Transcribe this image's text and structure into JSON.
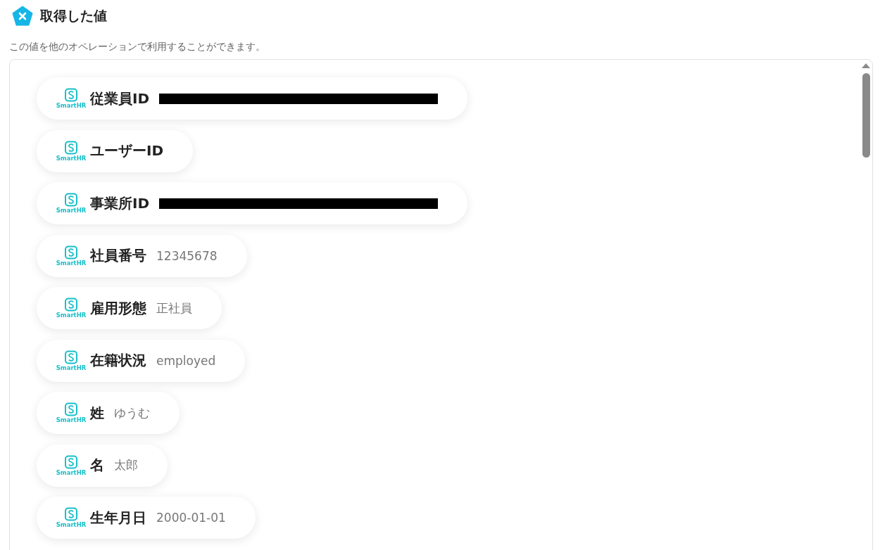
{
  "header": {
    "title": "取得した値",
    "description": "この値を他のオペレーションで利用することができます。"
  },
  "values": [
    {
      "label": "従業員ID",
      "kind": "redacted",
      "app": "SmartHR"
    },
    {
      "label": "ユーザーID",
      "kind": "empty",
      "app": "SmartHR"
    },
    {
      "label": "事業所ID",
      "kind": "redacted",
      "app": "SmartHR"
    },
    {
      "label": "社員番号",
      "kind": "text",
      "value": "12345678",
      "app": "SmartHR"
    },
    {
      "label": "雇用形態",
      "kind": "text",
      "value": "正社員",
      "app": "SmartHR"
    },
    {
      "label": "在籍状況",
      "kind": "text",
      "value": "employed",
      "app": "SmartHR"
    },
    {
      "label": "姓",
      "kind": "text",
      "value": "ゆうむ",
      "app": "SmartHR"
    },
    {
      "label": "名",
      "kind": "text",
      "value": "太郎",
      "app": "SmartHR"
    },
    {
      "label": "生年月日",
      "kind": "text",
      "value": "2000-01-01",
      "app": "SmartHR"
    }
  ]
}
